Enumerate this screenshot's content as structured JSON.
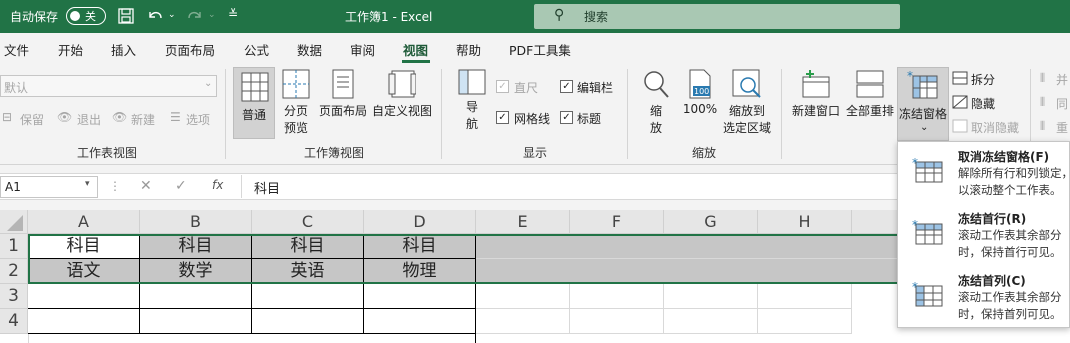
{
  "titlebar": {
    "autosave_label": "自动保存",
    "autosave_state": "关",
    "title": "工作簿1 - Excel",
    "search_placeholder": "搜索"
  },
  "tabs": [
    "文件",
    "开始",
    "插入",
    "页面布局",
    "公式",
    "数据",
    "审阅",
    "视图",
    "帮助",
    "PDF工具集"
  ],
  "active_tab": "视图",
  "ribbon": {
    "workbook_views_left": {
      "label": "工作表视图",
      "default_select": "默认",
      "keep": "保留",
      "exit": "退出",
      "new": "新建",
      "options": "选项"
    },
    "workbook_views": {
      "label": "工作簿视图",
      "normal": "普通",
      "page_break_1": "分页",
      "page_break_2": "预览",
      "page_layout": "页面布局",
      "custom_views": "自定义视图"
    },
    "show": {
      "label": "显示",
      "nav_1": "导",
      "nav_2": "航",
      "ruler": "直尺",
      "formula_bar": "编辑栏",
      "gridlines": "网格线",
      "headings": "标题"
    },
    "zoom": {
      "label": "缩放",
      "zoom_1": "缩",
      "zoom_2": "放",
      "hundred": "100%",
      "hundred_icon": "100",
      "zoom_sel_1": "缩放到",
      "zoom_sel_2": "选定区域"
    },
    "window": {
      "new_window": "新建窗口",
      "arrange_all": "全部重排",
      "freeze": "冻结窗格",
      "split": "拆分",
      "hide": "隐藏",
      "unhide": "取消隐藏",
      "side_by_side": "并",
      "sync": "同",
      "reset": "重"
    }
  },
  "formula_bar": {
    "name_box": "A1",
    "content": "科目",
    "fx": "fx"
  },
  "grid": {
    "columns": [
      "A",
      "B",
      "C",
      "D",
      "E",
      "F",
      "G",
      "H"
    ],
    "rows": [
      "1",
      "2",
      "3",
      "4"
    ],
    "cells": [
      [
        "科目",
        "科目",
        "科目",
        "科目"
      ],
      [
        "语文",
        "数学",
        "英语",
        "物理"
      ]
    ]
  },
  "freeze_menu": [
    {
      "title": "取消冻结窗格(F)",
      "desc": "解除所有行和列锁定，以滚动整个工作表。"
    },
    {
      "title": "冻结首行(R)",
      "desc": "滚动工作表其余部分时，保持首行可见。"
    },
    {
      "title": "冻结首列(C)",
      "desc": "滚动工作表其余部分时，保持首列可见。"
    }
  ]
}
